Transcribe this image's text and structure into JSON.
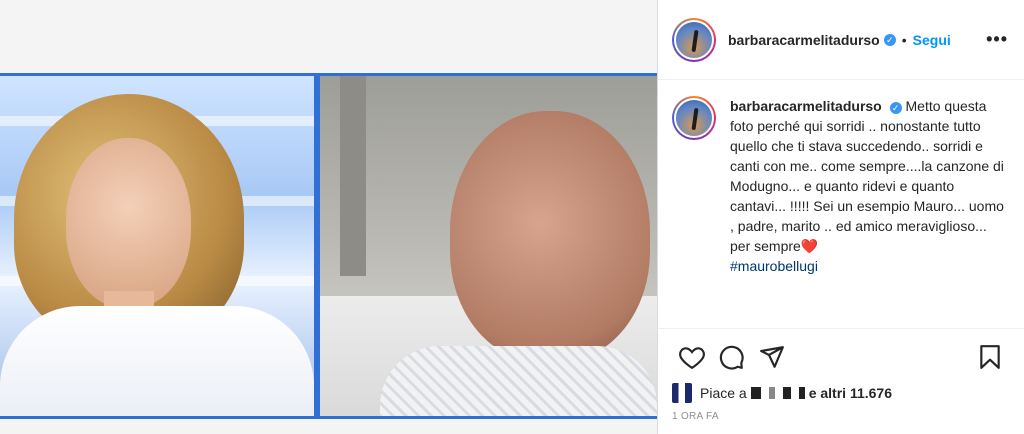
{
  "post": {
    "username": "barbaracarmelitadurso",
    "follow_label": "Segui",
    "more_label": "•••",
    "caption_username": "barbaracarmelitadurso",
    "caption_text": "Metto questa foto perché qui sorridi .. nonostante tutto quello che ti stava succedendo.. sorridi e canti con me.. come sempre....la canzone di Modugno... e quanto ridevi e quanto cantavi... !!!!! Sei un esempio Mauro... uomo , padre, marito .. ed amico meraviglioso... per sempre",
    "caption_emoji": "❤️",
    "hashtag": "#maurobellugi",
    "likes_prefix": "Piace a",
    "likes_suffix": "e altri",
    "likes_count": "11.676",
    "timestamp": "1 ORA FA"
  },
  "icons": {
    "like": "heart-icon",
    "comment": "comment-icon",
    "share": "share-icon",
    "save": "bookmark-icon"
  },
  "colors": {
    "accent": "#0095f6",
    "verified": "#3897f0",
    "hashtag": "#00376b"
  }
}
